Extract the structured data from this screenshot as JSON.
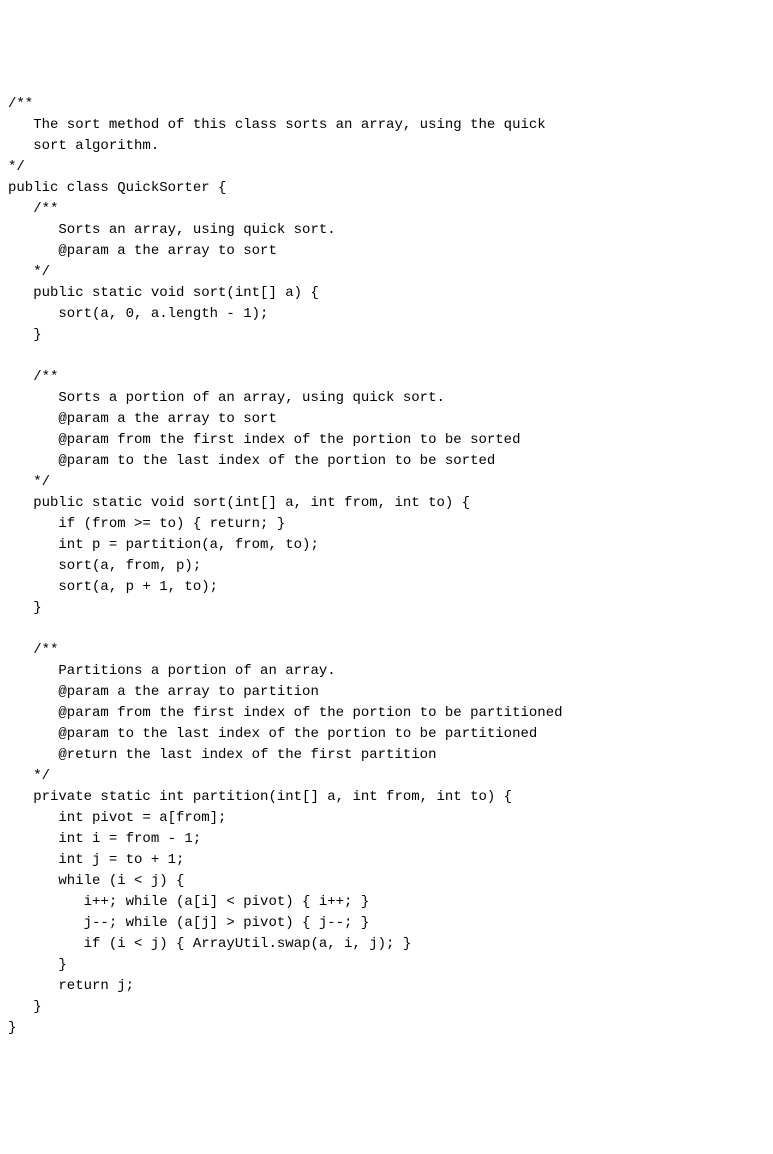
{
  "code": {
    "lines": [
      "/**",
      "   The sort method of this class sorts an array, using the quick",
      "   sort algorithm.",
      "*/",
      "public class QuickSorter {",
      "   /**",
      "      Sorts an array, using quick sort.",
      "      @param a the array to sort",
      "   */",
      "   public static void sort(int[] a) {",
      "      sort(a, 0, a.length - 1);",
      "   }",
      "",
      "   /**",
      "      Sorts a portion of an array, using quick sort.",
      "      @param a the array to sort",
      "      @param from the first index of the portion to be sorted",
      "      @param to the last index of the portion to be sorted",
      "   */",
      "   public static void sort(int[] a, int from, int to) {",
      "      if (from >= to) { return; }",
      "      int p = partition(a, from, to);",
      "      sort(a, from, p);",
      "      sort(a, p + 1, to);",
      "   }",
      "",
      "   /**",
      "      Partitions a portion of an array.",
      "      @param a the array to partition",
      "      @param from the first index of the portion to be partitioned",
      "      @param to the last index of the portion to be partitioned",
      "      @return the last index of the first partition",
      "   */",
      "   private static int partition(int[] a, int from, int to) {",
      "      int pivot = a[from];",
      "      int i = from - 1;",
      "      int j = to + 1;",
      "      while (i < j) {",
      "         i++; while (a[i] < pivot) { i++; }",
      "         j--; while (a[j] > pivot) { j--; }",
      "         if (i < j) { ArrayUtil.swap(a, i, j); }",
      "      }",
      "      return j;",
      "   }",
      "}"
    ]
  }
}
